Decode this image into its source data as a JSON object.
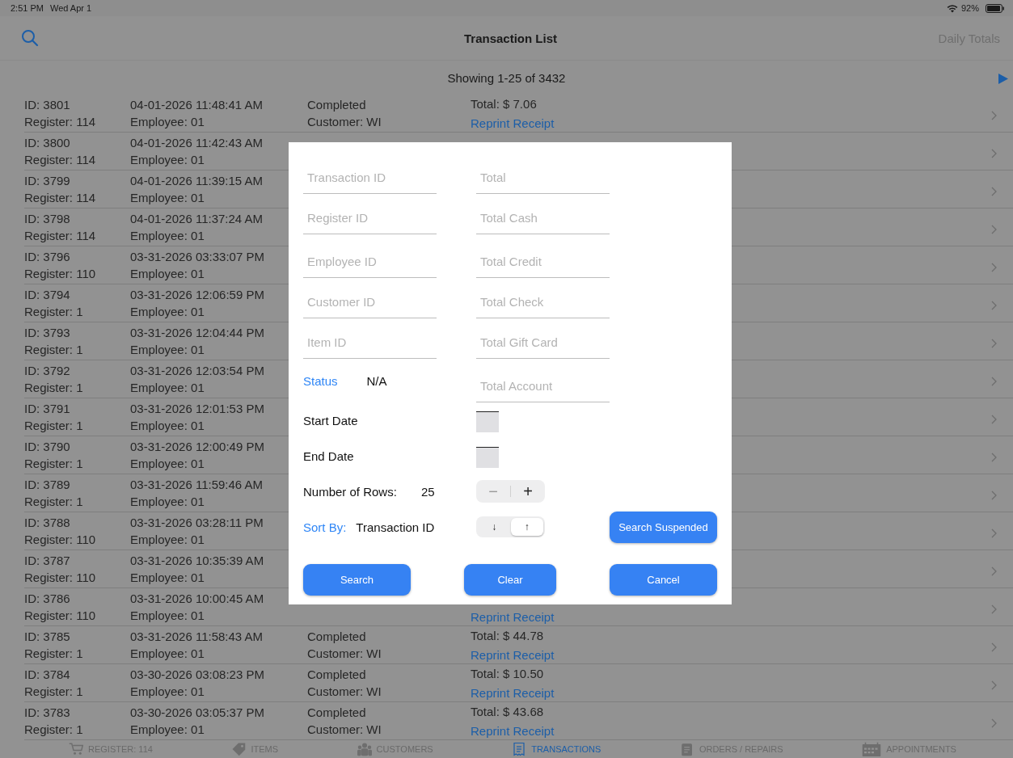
{
  "status_bar": {
    "time": "2:51 PM",
    "date": "Wed Apr 1",
    "battery": "92%"
  },
  "nav": {
    "title": "Transaction List",
    "action": "Daily Totals"
  },
  "pager": {
    "text": "Showing 1-25 of 3432"
  },
  "rows": [
    {
      "id": "ID: 3801",
      "register": "Register: 114",
      "datetime": "04-01-2026 11:48:41 AM",
      "employee": "Employee: 01",
      "status": "Completed",
      "customer": "Customer: WI",
      "total": "Total: $ 7.06",
      "link": "Reprint Receipt"
    },
    {
      "id": "ID: 3800",
      "register": "Register: 114",
      "datetime": "04-01-2026 11:42:43 AM",
      "employee": "Employee: 01"
    },
    {
      "id": "ID: 3799",
      "register": "Register: 114",
      "datetime": "04-01-2026 11:39:15 AM",
      "employee": "Employee: 01"
    },
    {
      "id": "ID: 3798",
      "register": "Register: 114",
      "datetime": "04-01-2026 11:37:24 AM",
      "employee": "Employee: 01"
    },
    {
      "id": "ID: 3796",
      "register": "Register: 110",
      "datetime": "03-31-2026 03:33:07 PM",
      "employee": "Employee: 01"
    },
    {
      "id": "ID: 3794",
      "register": "Register: 1",
      "datetime": "03-31-2026 12:06:59 PM",
      "employee": "Employee: 01"
    },
    {
      "id": "ID: 3793",
      "register": "Register: 1",
      "datetime": "03-31-2026 12:04:44 PM",
      "employee": "Employee: 01"
    },
    {
      "id": "ID: 3792",
      "register": "Register: 1",
      "datetime": "03-31-2026 12:03:54 PM",
      "employee": "Employee: 01"
    },
    {
      "id": "ID: 3791",
      "register": "Register: 1",
      "datetime": "03-31-2026 12:01:53 PM",
      "employee": "Employee: 01"
    },
    {
      "id": "ID: 3790",
      "register": "Register: 1",
      "datetime": "03-31-2026 12:00:49 PM",
      "employee": "Employee: 01"
    },
    {
      "id": "ID: 3789",
      "register": "Register: 1",
      "datetime": "03-31-2026 11:59:46 AM",
      "employee": "Employee: 01"
    },
    {
      "id": "ID: 3788",
      "register": "Register: 110",
      "datetime": "03-31-2026 03:28:11 PM",
      "employee": "Employee: 01"
    },
    {
      "id": "ID: 3787",
      "register": "Register: 110",
      "datetime": "03-31-2026 10:35:39 AM",
      "employee": "Employee: 01"
    },
    {
      "id": "ID: 3786",
      "register": "Register: 110",
      "datetime": "03-31-2026 10:00:45 AM",
      "employee": "Employee: 01",
      "link": "Reprint Receipt"
    },
    {
      "id": "ID: 3785",
      "register": "Register: 1",
      "datetime": "03-31-2026 11:58:43 AM",
      "employee": "Employee: 01",
      "status": "Completed",
      "customer": "Customer: WI",
      "total": "Total: $ 44.78",
      "link": "Reprint Receipt"
    },
    {
      "id": "ID: 3784",
      "register": "Register: 1",
      "datetime": "03-30-2026 03:08:23 PM",
      "employee": "Employee: 01",
      "status": "Completed",
      "customer": "Customer: WI",
      "total": "Total: $ 10.50",
      "link": "Reprint Receipt"
    },
    {
      "id": "ID: 3783",
      "register": "Register: 1",
      "datetime": "03-30-2026 03:05:37 PM",
      "employee": "Employee: 01",
      "status": "Completed",
      "customer": "Customer: WI",
      "total": "Total: $ 43.68",
      "link": "Reprint Receipt"
    }
  ],
  "filter_dialog": {
    "fields_left": [
      {
        "placeholder": "Transaction ID"
      },
      {
        "placeholder": "Register ID"
      },
      {
        "placeholder": "Employee ID"
      },
      {
        "placeholder": "Customer ID"
      },
      {
        "placeholder": "Item ID"
      }
    ],
    "fields_right": [
      {
        "placeholder": "Total"
      },
      {
        "placeholder": "Total Cash"
      },
      {
        "placeholder": "Total Credit"
      },
      {
        "placeholder": "Total Check"
      },
      {
        "placeholder": "Total Gift Card"
      },
      {
        "placeholder": "Total Account"
      }
    ],
    "status": {
      "label": "Status",
      "value": "N/A"
    },
    "start_date": {
      "label": "Start Date"
    },
    "end_date": {
      "label": "End Date"
    },
    "row_count": {
      "label": "Number of Rows:",
      "value": "25",
      "minus": "−",
      "plus": "+"
    },
    "sort": {
      "label": "Sort By:",
      "value": "Transaction ID",
      "options": [
        {
          "glyph": "↓",
          "selected": false
        },
        {
          "glyph": "↑",
          "selected": true
        }
      ]
    },
    "suspended_button": "Search Suspended",
    "buttons": [
      "Search",
      "Clear",
      "Cancel"
    ]
  },
  "tab_bar": {
    "items": [
      {
        "label": "REGISTER: 114",
        "kind": "cart",
        "selected": false
      },
      {
        "label": "ITEMS",
        "kind": "tag",
        "selected": false
      },
      {
        "label": "CUSTOMERS",
        "kind": "people",
        "selected": false
      },
      {
        "label": "TRANSACTIONS",
        "kind": "receipt",
        "selected": true
      },
      {
        "label": "ORDERS / REPAIRS",
        "kind": "clipboard",
        "selected": false
      },
      {
        "label": "APPOINTMENTS",
        "kind": "calendar",
        "selected": false
      }
    ]
  }
}
